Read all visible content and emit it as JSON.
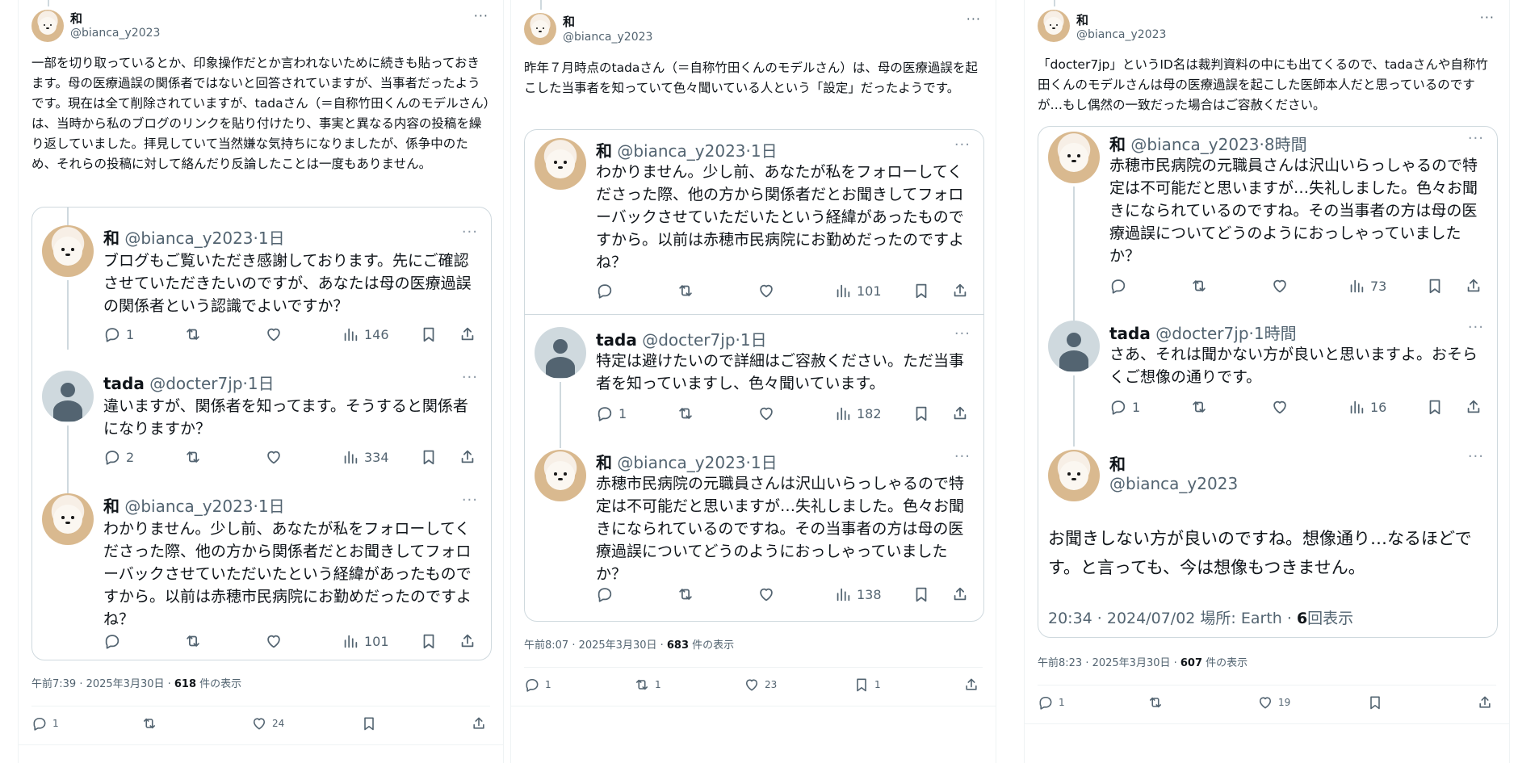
{
  "col1": {
    "author": {
      "name": "和",
      "handle": "@bianca_y2023"
    },
    "text": "一部を切り取っているとか、印象操作だとか言われないために続きも貼っておきます。母の医療過誤の関係者ではないと回答されていますが、当事者だったようです。現在は全て削除されていますが、tadaさん（＝自称竹田くんのモデルさん）は、当時から私のブログのリンクを貼り付けたり、事実と異なる内容の投稿を繰り返していました。拝見していて当然嫌な気持ちになりましたが、係争中のため、それらの投稿に対して絡んだり反論したことは一度もありません。",
    "quotes": [
      {
        "name": "和",
        "handle": "@bianca_y2023",
        "time": "·1日",
        "text": "ブログもご覧いただき感謝しております。先にご確認させていただきたいのですが、あなたは母の医療過誤の関係者という認識でよいですか？",
        "replies": "1",
        "views": "146"
      },
      {
        "name": "tada",
        "handle": "@docter7jp",
        "time": "·1日",
        "text": "違いますが、関係者を知ってます。そうすると関係者になりますか？",
        "replies": "2",
        "views": "334"
      },
      {
        "name": "和",
        "handle": "@bianca_y2023",
        "time": "·1日",
        "text": "わかりません。少し前、あなたが私をフォローしてくださった際、他の方から関係者だとお聞きしてフォローバックさせていただいたという経緯があったものですから。以前は赤穂市民病院にお勤めだったのですよね？",
        "replies": "",
        "views": "101"
      }
    ],
    "timestamp": "午前7:39 · 2025年3月30日 · ",
    "views_count": "618",
    "views_label": " 件の表示",
    "stats": {
      "replies": "1",
      "retweets": "",
      "likes": "24",
      "bookmarks": ""
    }
  },
  "col2": {
    "author": {
      "name": "和",
      "handle": "@bianca_y2023"
    },
    "text": "昨年７月時点のtadaさん（＝自称竹田くんのモデルさん）は、母の医療過誤を起こした当事者を知っていて色々聞いている人という「設定」だったようです。",
    "quotes": [
      {
        "name": "和",
        "handle": "@bianca_y2023",
        "time": "·1日",
        "text": "わかりません。少し前、あなたが私をフォローしてくださった際、他の方から関係者だとお聞きしてフォローバックさせていただいたという経緯があったものですから。以前は赤穂市民病院にお勤めだったのですよね？",
        "replies": "",
        "views": "101"
      },
      {
        "name": "tada",
        "handle": "@docter7jp",
        "time": "·1日",
        "text": "特定は避けたいので詳細はご容赦ください。ただ当事者を知っていますし、色々聞いています。",
        "replies": "1",
        "views": "182"
      },
      {
        "name": "和",
        "handle": "@bianca_y2023",
        "time": "·1日",
        "text": "赤穂市民病院の元職員さんは沢山いらっしゃるので特定は不可能だと思いますが…失礼しました。色々お聞きになられているのですね。その当事者の方は母の医療過誤についてどうのようにおっしゃっていましたか？",
        "replies": "",
        "views": "138"
      }
    ],
    "timestamp": "午前8:07 · 2025年3月30日 · ",
    "views_count": "683",
    "views_label": " 件の表示",
    "stats": {
      "replies": "1",
      "retweets": "1",
      "likes": "23",
      "bookmarks": "1"
    }
  },
  "col3": {
    "author": {
      "name": "和",
      "handle": "@bianca_y2023"
    },
    "text": "「docter7jp」というID名は裁判資料の中にも出てくるので、tadaさんや自称竹田くんのモデルさんは母の医療過誤を起こした医師本人だと思っているのですが…もし偶然の一致だった場合はご容赦ください。",
    "quotes": [
      {
        "name": "和",
        "handle": "@bianca_y2023",
        "time": "·8時間",
        "text": "赤穂市民病院の元職員さんは沢山いらっしゃるので特定は不可能だと思いますが…失礼しました。色々お聞きになられているのですね。その当事者の方は母の医療過誤についてどうのようにおっしゃっていましたか？",
        "replies": "",
        "views": "73"
      },
      {
        "name": "tada",
        "handle": "@docter7jp",
        "time": "·1時間",
        "text": "さあ、それは聞かない方が良いと思いますよ。おそらくご想像の通りです。",
        "replies": "1",
        "views": "16"
      }
    ],
    "main_quote": {
      "name": "和",
      "handle": "@bianca_y2023",
      "text": "お聞きしない方が良いのですね。想像通り…なるほどです。と言っても、今は想像もつきません。",
      "meta": "20:34 · 2024/07/02 場所: Earth · ",
      "views_count": "6",
      "views_label": "回表示"
    },
    "timestamp": "午前8:23 · 2025年3月30日 · ",
    "views_count": "607",
    "views_label": " 件の表示",
    "stats": {
      "replies": "1",
      "retweets": "",
      "likes": "19",
      "bookmarks": ""
    }
  },
  "more_glyph": "···",
  "colors": {
    "text": "#0f1419",
    "secondary": "#536471",
    "border": "#cfd9de"
  }
}
